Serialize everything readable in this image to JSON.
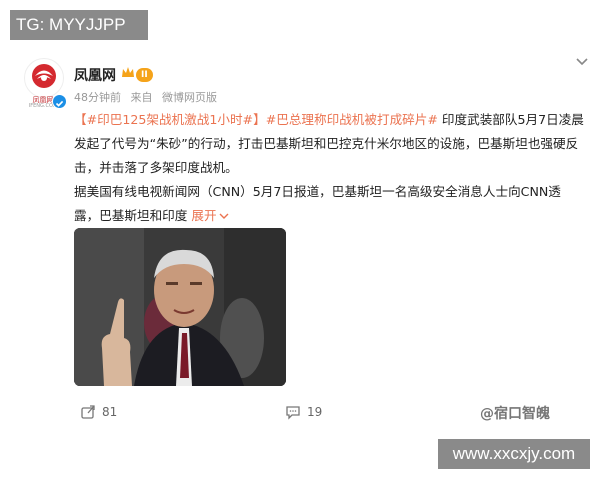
{
  "overlay": {
    "top_label": "TG: MYYJJPP",
    "bottom_label": "www.xxcxjy.com",
    "corner_mark": "@宿口智魄"
  },
  "post": {
    "account": {
      "name": "凤凰网",
      "avatar_caption": "凤凰网",
      "avatar_caption_sub": "IFENG.COM",
      "badge": "II",
      "icons": [
        "crown-icon",
        "verified-icon"
      ]
    },
    "meta": {
      "time": "48分钟前",
      "source_prefix": "来自",
      "source": "微博网页版"
    },
    "text": {
      "hashtag_1": "【#印巴125架战机激战1小时#】",
      "hashtag_2": "#巴总理称印战机被打成碎片#",
      "body_1": " 印度武装部队5月7日凌晨发起了代号为“朱砂”的行动，打击巴基斯坦和巴控克什米尔地区的设施，巴基斯坦也强硬反击，并击落了多架印度战机。",
      "body_2": "据美国有线电视新闻网（CNN）5月7日报道，巴基斯坦一名高级安全消息人士向CNN透露，巴基斯坦和印度",
      "expand": "展开"
    },
    "actions": {
      "repost_count": "81",
      "comment_count": "19"
    }
  },
  "colors": {
    "accent": "#eb7350",
    "verified": "#1b8fe6",
    "badge": "#f5a31a"
  }
}
